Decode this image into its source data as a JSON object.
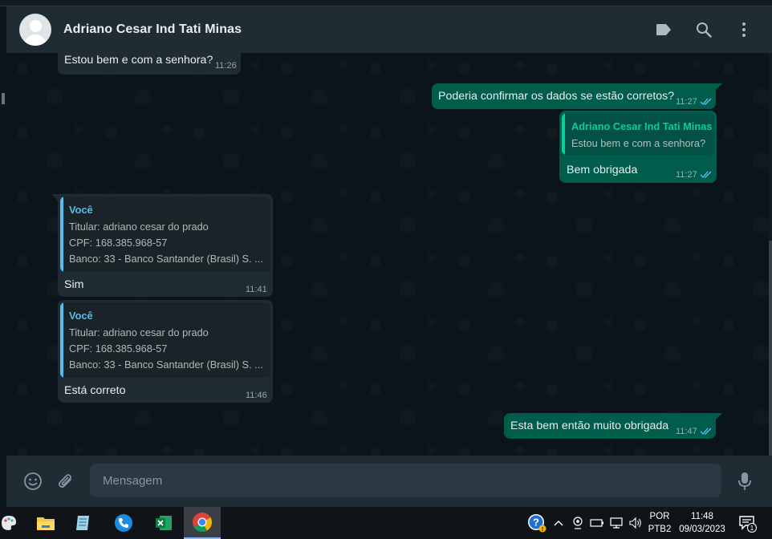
{
  "header": {
    "contact_name": "Adriano Cesar Ind Tati Minas"
  },
  "messages": [
    {
      "direction": "in",
      "text": "Estou bem e com a senhora?",
      "time": "11:26"
    },
    {
      "direction": "out",
      "text": "Poderia confirmar os dados se estão corretos?",
      "time": "11:27",
      "status": "read"
    },
    {
      "direction": "out",
      "quoted_author": "Adriano Cesar Ind Tati Minas",
      "quoted_text": "Estou bem e com a senhora?",
      "text": "Bem obrigada",
      "time": "11:27",
      "status": "read"
    },
    {
      "direction": "in",
      "quoted_author": "Você",
      "quoted_lines": [
        "Titular: adriano cesar do prado",
        "CPF: 168.385.968-57",
        "Banco: 33 - Banco Santander (Brasil) S. ..."
      ],
      "text": "Sim",
      "time": "11:41"
    },
    {
      "direction": "in",
      "quoted_author": "Você",
      "quoted_lines": [
        "Titular: adriano cesar do prado",
        "CPF: 168.385.968-57",
        "Banco: 33 - Banco Santander (Brasil) S. ..."
      ],
      "text": "Está correto",
      "time": "11:46"
    },
    {
      "direction": "out",
      "text": "Esta bem então muito obrigada",
      "time": "11:47",
      "status": "read"
    }
  ],
  "footer": {
    "placeholder": "Mensagem"
  },
  "taskbar": {
    "apps": [
      "palette-icon",
      "file-explorer-icon",
      "notepad-icon",
      "phone-app-icon",
      "excel-icon",
      "chrome-icon"
    ],
    "active_app": "chrome-icon",
    "lang_top": "POR",
    "lang_bottom": "PTB2",
    "time": "11:48",
    "date": "09/03/2023",
    "notification_count": "1"
  },
  "colors": {
    "header_bg": "#202c33",
    "chat_bg": "#0b141a",
    "incoming_bubble": "#202c33",
    "outgoing_bubble": "#005c4b",
    "read_tick": "#53bdeb",
    "you_quote_color": "#53bdeb",
    "contact_quote_color": "#06cf9c"
  }
}
